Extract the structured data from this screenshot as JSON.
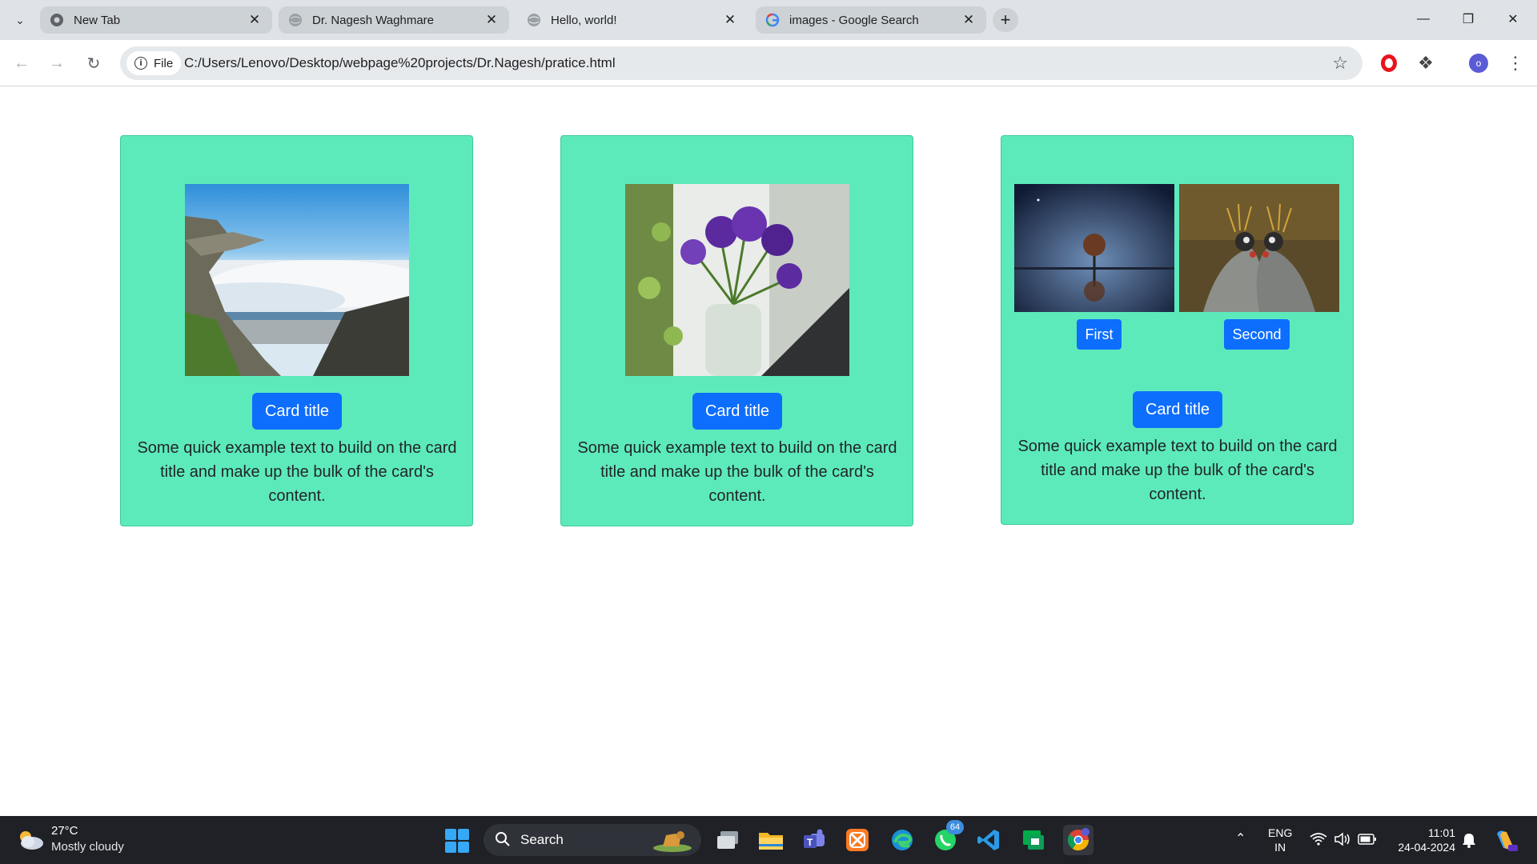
{
  "browser": {
    "tabs": [
      {
        "title": "New Tab",
        "favicon": "chrome-icon",
        "active": false
      },
      {
        "title": "Dr. Nagesh Waghmare",
        "favicon": "globe-icon",
        "active": false
      },
      {
        "title": "Hello, world!",
        "favicon": "globe-icon",
        "active": true
      },
      {
        "title": "images - Google Search",
        "favicon": "google-icon",
        "active": false
      }
    ],
    "new_tab_label": "+",
    "chip_label": "File",
    "url": "C:/Users/Lenovo/Desktop/webpage%20projects/Dr.Nagesh/pratice.html",
    "profile_initial": "o"
  },
  "cards": [
    {
      "image": "cliff-ocean-landscape",
      "button": "Card title",
      "text": "Some quick example text to build on the card title and make up the bulk of the card's content."
    },
    {
      "image": "purple-flowers-vase",
      "button": "Card title",
      "text": "Some quick example text to build on the card title and make up the bulk of the card's content."
    },
    {
      "images": [
        "tree-reflection-night",
        "crowned-cranes"
      ],
      "small_buttons": [
        "First",
        "Second"
      ],
      "button": "Card title",
      "text": "Some quick example text to build on the card title and make up the bulk of the card's content."
    }
  ],
  "taskbar": {
    "weather_temp": "27°C",
    "weather_desc": "Mostly cloudy",
    "search_label": "Search",
    "whatsapp_badge": "64",
    "lang_top": "ENG",
    "lang_bottom": "IN",
    "time": "11:01",
    "date": "24-04-2024"
  },
  "colors": {
    "card_bg": "#5deabb",
    "button_bg": "#0d6efd",
    "tabbar_bg": "#dfe3e7",
    "taskbar_bg": "#1f2126"
  }
}
